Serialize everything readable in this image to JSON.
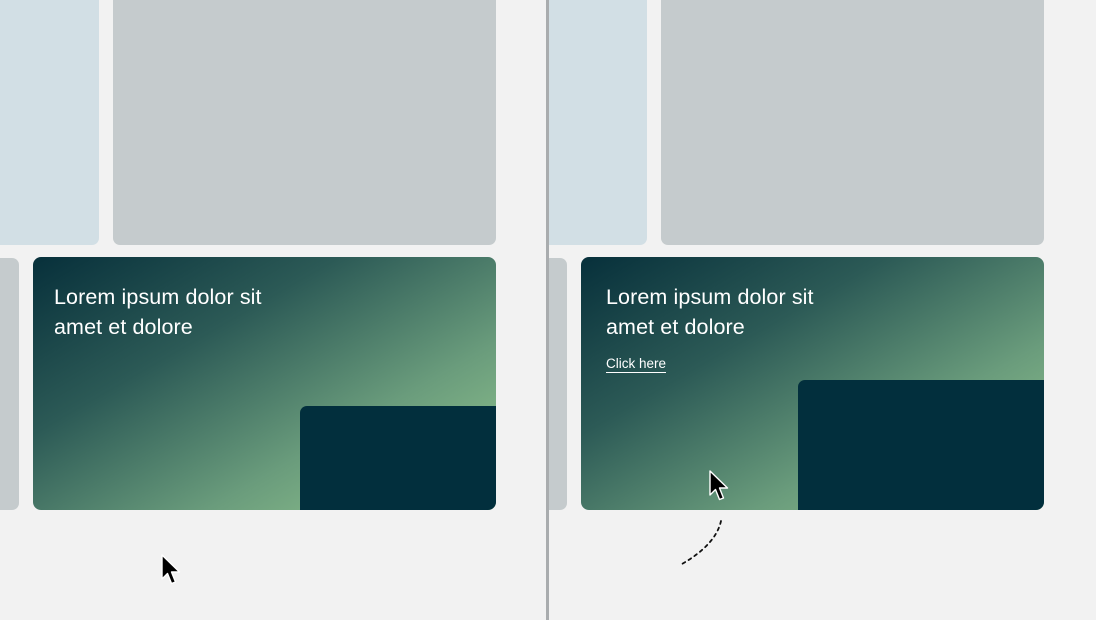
{
  "left_state": {
    "card": {
      "title": "Lorem ipsum dolor sit amet et dolore"
    },
    "cursor_icon": "pointer-cursor-icon"
  },
  "right_state": {
    "card": {
      "title": "Lorem ipsum dolor sit amet et dolore",
      "link_label": "Click here"
    },
    "cursor_icon": "pointer-cursor-icon",
    "motion_icon": "dashed-motion-trail-icon"
  },
  "colors": {
    "background": "#f2f2f2",
    "tile_blue": "#d2dfe5",
    "tile_gray": "#c5cbcd",
    "card_gradient_start": "#07303b",
    "card_gradient_end": "#98cc92",
    "card_block": "#022f3d",
    "text": "#ffffff",
    "divider": "#a9acae"
  }
}
